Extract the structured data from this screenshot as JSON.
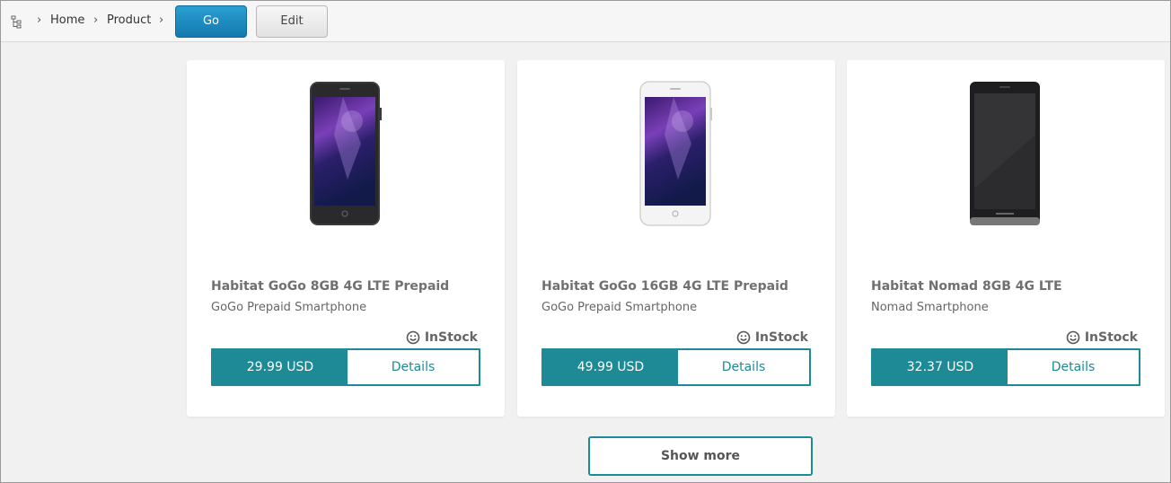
{
  "breadcrumb": {
    "items": [
      {
        "label": "Home"
      },
      {
        "label": "Product"
      }
    ]
  },
  "toolbar": {
    "go_label": "Go",
    "edit_label": "Edit"
  },
  "products": [
    {
      "title": "Habitat GoGo 8GB 4G LTE Prepaid",
      "subtitle": "GoGo Prepaid Smartphone",
      "stock": "InStock",
      "price": "29.99 USD",
      "details_label": "Details",
      "image": "black-smartphone-galaxy-screen"
    },
    {
      "title": "Habitat GoGo 16GB 4G LTE Prepaid",
      "subtitle": "GoGo Prepaid Smartphone",
      "stock": "InStock",
      "price": "49.99 USD",
      "details_label": "Details",
      "image": "white-smartphone-galaxy-screen"
    },
    {
      "title": "Habitat Nomad 8GB 4G LTE",
      "subtitle": "Nomad Smartphone",
      "stock": "InStock",
      "price": "32.37 USD",
      "details_label": "Details",
      "image": "black-smartphone-dark-screen"
    }
  ],
  "show_more_label": "Show more",
  "colors": {
    "accent": "#1d8a96",
    "go_button": "#1f8cc2",
    "background": "#f1f1f1"
  }
}
